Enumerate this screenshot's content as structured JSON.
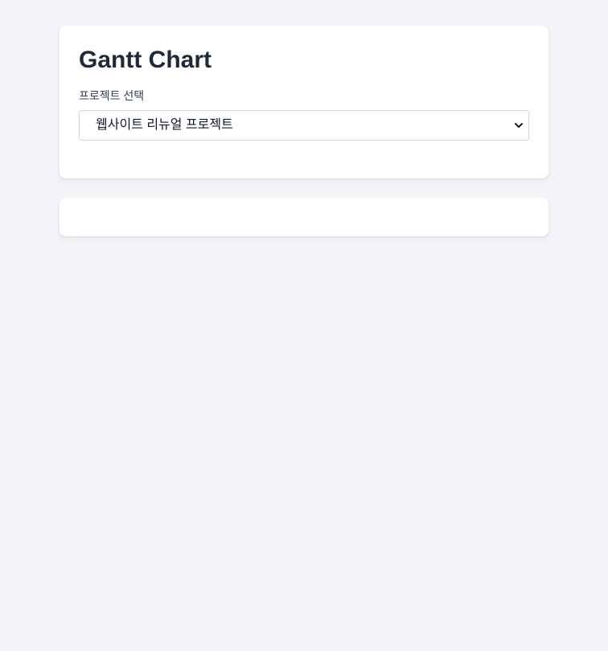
{
  "header": {
    "title": "Gantt Chart"
  },
  "project_select": {
    "label": "프로젝트 선택",
    "selected": "웹사이트 리뉴얼 프로젝트",
    "icon": "chevron-down-icon"
  },
  "colors": {
    "background": "#f2f4f7",
    "card": "#ffffff",
    "title": "#1f2937",
    "border": "#d1d5db"
  }
}
